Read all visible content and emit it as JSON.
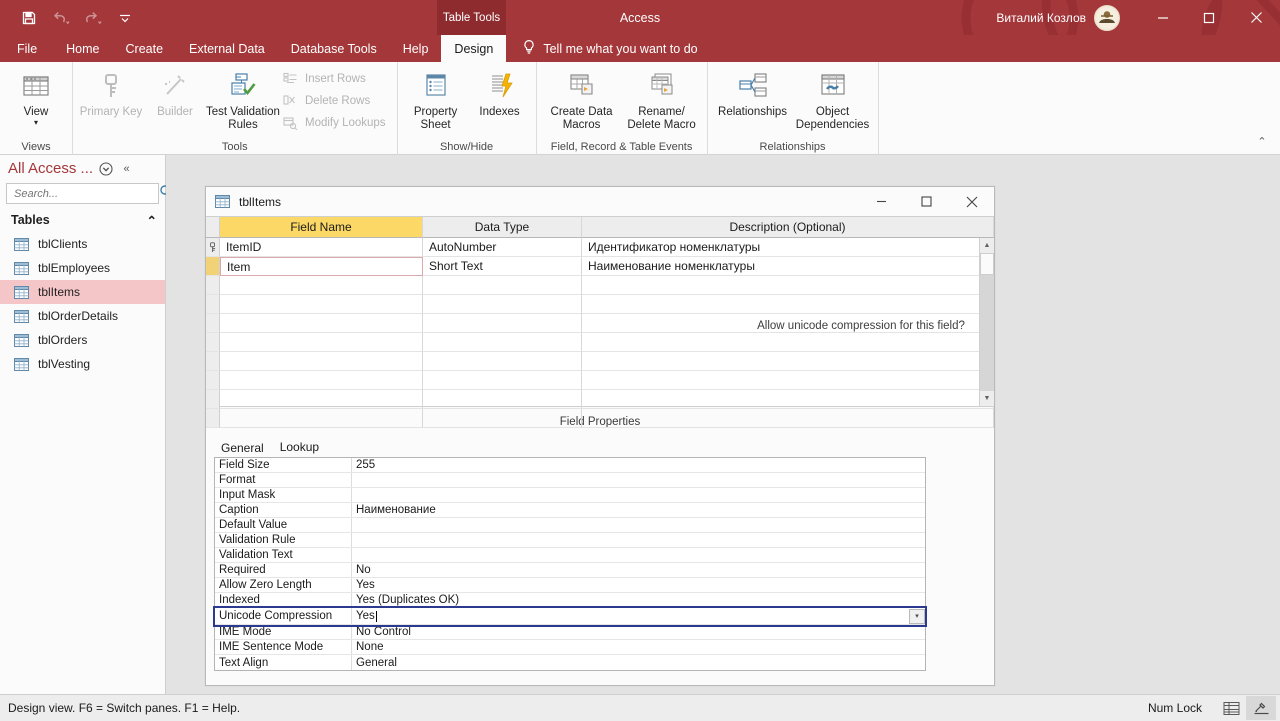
{
  "titlebar": {
    "app_title": "Access",
    "contextual_tab_group": "Table Tools",
    "user_name": "Виталий Козлов",
    "quick_access": [
      {
        "name": "save-icon",
        "label": "Save"
      },
      {
        "name": "undo-icon",
        "label": "Undo"
      },
      {
        "name": "redo-icon",
        "label": "Redo"
      },
      {
        "name": "customize-qat-icon",
        "label": "Customize Quick Access Toolbar"
      }
    ],
    "window_controls": [
      {
        "name": "minimize-button",
        "glyph": "—"
      },
      {
        "name": "maximize-button",
        "glyph": "□"
      },
      {
        "name": "close-button",
        "glyph": "✕"
      }
    ]
  },
  "ribbon_tabs": [
    {
      "label": "File",
      "active": false
    },
    {
      "label": "Home",
      "active": false
    },
    {
      "label": "Create",
      "active": false
    },
    {
      "label": "External Data",
      "active": false
    },
    {
      "label": "Database Tools",
      "active": false
    },
    {
      "label": "Help",
      "active": false
    },
    {
      "label": "Design",
      "active": true
    }
  ],
  "tell_me": "Tell me what you want to do",
  "ribbon": {
    "groups": [
      {
        "label": "Views",
        "big_buttons": [
          {
            "label": "View",
            "icon": "table-view-icon",
            "dropdown": true,
            "disabled": false
          }
        ],
        "small_buttons": []
      },
      {
        "label": "Tools",
        "big_buttons": [
          {
            "label": "Primary Key",
            "icon": "key-icon",
            "dropdown": false,
            "disabled": true
          },
          {
            "label": "Builder",
            "icon": "wand-icon",
            "dropdown": false,
            "disabled": true
          },
          {
            "label": "Test Validation Rules",
            "icon": "validation-check-icon",
            "dropdown": false,
            "disabled": false
          }
        ],
        "small_buttons": [
          {
            "label": "Insert Rows",
            "icon": "insert-rows-icon",
            "disabled": true
          },
          {
            "label": "Delete Rows",
            "icon": "delete-rows-icon",
            "disabled": true
          },
          {
            "label": "Modify Lookups",
            "icon": "modify-lookups-icon",
            "disabled": true
          }
        ]
      },
      {
        "label": "Show/Hide",
        "big_buttons": [
          {
            "label": "Property Sheet",
            "icon": "property-sheet-icon",
            "dropdown": false,
            "disabled": false
          },
          {
            "label": "Indexes",
            "icon": "indexes-icon",
            "dropdown": false,
            "disabled": false
          }
        ],
        "small_buttons": []
      },
      {
        "label": "Field, Record & Table Events",
        "big_buttons": [
          {
            "label": "Create Data Macros",
            "icon": "create-data-macros-icon",
            "dropdown": true,
            "disabled": false
          },
          {
            "label": "Rename/ Delete Macro",
            "icon": "rename-delete-macro-icon",
            "dropdown": false,
            "disabled": false
          }
        ],
        "small_buttons": []
      },
      {
        "label": "Relationships",
        "big_buttons": [
          {
            "label": "Relationships",
            "icon": "relationships-icon",
            "dropdown": false,
            "disabled": false
          },
          {
            "label": "Object Dependencies",
            "icon": "object-dependencies-icon",
            "dropdown": false,
            "disabled": false
          }
        ],
        "small_buttons": []
      }
    ],
    "collapse_glyph": "⌃"
  },
  "nav_pane": {
    "title": "All Access ...",
    "menu_glyph": "⌄",
    "collapse_glyph": "«",
    "search_placeholder": "Search...",
    "search_value": "",
    "group_label": "Tables",
    "group_collapse_glyph": "⌃",
    "items": [
      {
        "label": "tblClients",
        "selected": false
      },
      {
        "label": "tblEmployees",
        "selected": false
      },
      {
        "label": "tblItems",
        "selected": true
      },
      {
        "label": "tblOrderDetails",
        "selected": false
      },
      {
        "label": "tblOrders",
        "selected": false
      },
      {
        "label": "tblVesting",
        "selected": false
      }
    ]
  },
  "table_window": {
    "title": "tblItems",
    "controls": [
      {
        "name": "tw-minimize-button",
        "glyph": "—"
      },
      {
        "name": "tw-maximize-button",
        "glyph": "□"
      },
      {
        "name": "tw-close-button",
        "glyph": "✕"
      }
    ],
    "grid": {
      "columns": [
        "Field Name",
        "Data Type",
        "Description (Optional)"
      ],
      "rows": [
        {
          "field_name": "ItemID",
          "data_type": "AutoNumber",
          "description": "Идентификатор номенклатуры",
          "primary_key": true,
          "selected": false
        },
        {
          "field_name": "Item",
          "data_type": "Short Text",
          "description": "Наименование номенклатуры",
          "primary_key": false,
          "selected": true
        }
      ],
      "empty_row_count": 7
    },
    "field_properties_caption": "Field Properties",
    "property_tabs": [
      {
        "label": "General",
        "active": true
      },
      {
        "label": "Lookup",
        "active": false
      }
    ],
    "properties": [
      {
        "name": "Field Size",
        "value": "255",
        "focused": false
      },
      {
        "name": "Format",
        "value": "",
        "focused": false
      },
      {
        "name": "Input Mask",
        "value": "",
        "focused": false
      },
      {
        "name": "Caption",
        "value": "Наименование",
        "focused": false
      },
      {
        "name": "Default Value",
        "value": "",
        "focused": false
      },
      {
        "name": "Validation Rule",
        "value": "",
        "focused": false
      },
      {
        "name": "Validation Text",
        "value": "",
        "focused": false
      },
      {
        "name": "Required",
        "value": "No",
        "focused": false
      },
      {
        "name": "Allow Zero Length",
        "value": "Yes",
        "focused": false
      },
      {
        "name": "Indexed",
        "value": "Yes (Duplicates OK)",
        "focused": false
      },
      {
        "name": "Unicode Compression",
        "value": "Yes",
        "focused": true
      },
      {
        "name": "IME Mode",
        "value": "No Control",
        "focused": false
      },
      {
        "name": "IME Sentence Mode",
        "value": "None",
        "focused": false
      },
      {
        "name": "Text Align",
        "value": "General",
        "focused": false
      }
    ],
    "help_text": "Allow unicode compression for this field?"
  },
  "status_bar": {
    "message": "Design view.  F6 = Switch panes.  F1 = Help.",
    "num_lock": "Num Lock",
    "view_buttons": [
      {
        "name": "datasheet-view-button",
        "active": false
      },
      {
        "name": "design-view-button",
        "active": true
      }
    ]
  },
  "colors": {
    "accent_red": "#a4373a",
    "contextual_tab_dark": "#8e2b2e",
    "ribbon_bg": "#fbfbfb",
    "workspace_bg": "#e3e3e3",
    "field_name_header": "#fcd866",
    "nav_selection": "#f5c6c8",
    "focus_outline": "#2b3a8f"
  }
}
